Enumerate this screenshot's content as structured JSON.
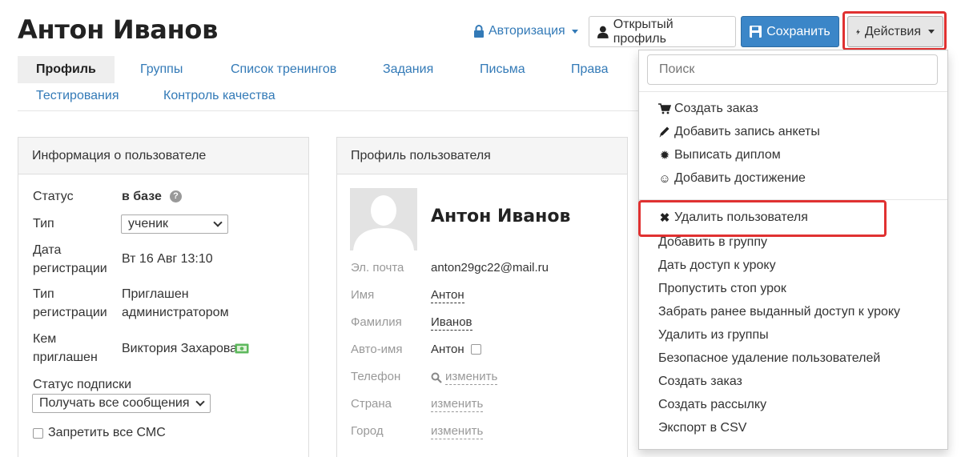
{
  "header": {
    "title": "Антон Иванов",
    "auth_label": "Авторизация",
    "open_profile_label": "Открытый профиль",
    "save_label": "Сохранить",
    "actions_label": "Действия"
  },
  "tabs": [
    {
      "label": "Профиль",
      "active": true
    },
    {
      "label": "Группы"
    },
    {
      "label": "Список тренингов"
    },
    {
      "label": "Задания"
    },
    {
      "label": "Письма"
    },
    {
      "label": "Права"
    },
    {
      "label": "Тестирования"
    },
    {
      "label": "Контроль качества"
    }
  ],
  "user_info": {
    "header": "Информация о пользователе",
    "status_label": "Статус",
    "status_value": "в базе",
    "type_label": "Тип",
    "type_value": "ученик",
    "reg_date_label_1": "Дата",
    "reg_date_label_2": "регистрации",
    "reg_date_value": "Вт 16 Авг 13:10",
    "reg_type_label_1": "Тип",
    "reg_type_label_2": "регистрации",
    "reg_type_value_1": "Приглашен",
    "reg_type_value_2": "администратором",
    "invited_label_1": "Кем",
    "invited_label_2": "приглашен",
    "invited_value": "Виктория Захарова",
    "subscription_label": "Статус подписки",
    "subscription_value": "Получать все сообщения",
    "sms_label": "Запретить все СМС"
  },
  "profile": {
    "header": "Профиль пользователя",
    "name": "Антон Иванов",
    "email_label": "Эл. почта",
    "email_value": "anton29gc22@mail.ru",
    "first_name_label": "Имя",
    "first_name_value": "Антон",
    "last_name_label": "Фамилия",
    "last_name_value": "Иванов",
    "autoname_label": "Авто-имя",
    "autoname_value": "Антон",
    "phone_label": "Телефон",
    "phone_value": "изменить",
    "country_label": "Страна",
    "country_value": "изменить",
    "city_label": "Город",
    "city_value": "изменить"
  },
  "actions_menu": {
    "search_placeholder": "Поиск",
    "icon_items": [
      {
        "label": "Создать заказ",
        "icon": "cart-icon"
      },
      {
        "label": "Добавить запись анкеты",
        "icon": "pencil-icon"
      },
      {
        "label": "Выписать диплом",
        "icon": "certificate-icon"
      },
      {
        "label": "Добавить достижение",
        "icon": "smile-icon"
      }
    ],
    "delete_user": "Удалить пользователя",
    "items": [
      "Добавить в группу",
      "Дать доступ к уроку",
      "Пропустить стоп урок",
      "Забрать ранее выданный доступ к уроку",
      "Удалить из группы",
      "Безопасное удаление пользователей",
      "Создать заказ",
      "Создать рассылку",
      "Экспорт в CSV"
    ]
  },
  "colors": {
    "link": "#337ab7",
    "save_button": "#3b86c8",
    "highlight": "#e03131",
    "invited_badge": "#5cb85c"
  }
}
